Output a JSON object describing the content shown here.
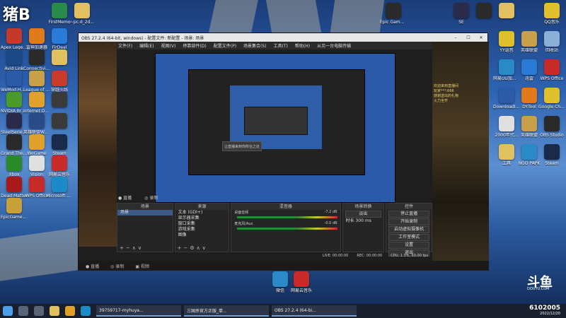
{
  "stream_label": "猪B",
  "desktop_left": [
    {
      "name": "Apex Legends",
      "c": "#c43a2a"
    },
    {
      "name": "雷神加速器",
      "c": "#e07a1a"
    },
    {
      "name": "FirDeal",
      "c": "#2a7ad8"
    },
    {
      "name": "Avid Link",
      "c": "#1a4a88"
    },
    {
      "name": "ConnectivityUtil",
      "c": "#2a2a2a"
    },
    {
      "name": "",
      "c": "#e0c060"
    },
    {
      "name": "WeMod Helper",
      "c": "#2a5aa8"
    },
    {
      "name": "League of Legends",
      "c": "#c8a04a"
    },
    {
      "name": "穿越火线",
      "c": "#c83a2a"
    },
    {
      "name": "NVIDIA Broadcast",
      "c": "#4a9a2a"
    },
    {
      "name": "Internet Download",
      "c": "#e0a02a"
    },
    {
      "name": "",
      "c": "#3a3a3a"
    },
    {
      "name": "SteelSeries GG",
      "c": "#2a2a4a"
    },
    {
      "name": "英雄联盟WeGame",
      "c": "#2a4a88"
    },
    {
      "name": "",
      "c": "#3a3a3a"
    },
    {
      "name": "Grand Theft Auto",
      "c": "#2a2a2a"
    },
    {
      "name": "WeGame",
      "c": "#e0a02a"
    },
    {
      "name": "Steam",
      "c": "#1a2a4a"
    },
    {
      "name": "Xbox",
      "c": "#2a8a2a"
    },
    {
      "name": "Vision",
      "c": "#e0e0e0"
    },
    {
      "name": "网易云音乐",
      "c": "#c82a2a"
    },
    {
      "name": "Dead Matter",
      "c": "#a81a1a"
    },
    {
      "name": "WPS Office",
      "c": "#c82a2a"
    },
    {
      "name": "Microsoft Edge",
      "c": "#1a8ac8"
    },
    {
      "name": "EpicGames Launcher",
      "c": "#c8a03a"
    }
  ],
  "desktop_top": [
    {
      "name": "FirstMemo",
      "c": "#2a8a4a"
    },
    {
      "name": "~pc.d_2d...",
      "c": "#e0c060"
    },
    {
      "name": "Epic Games Launcher",
      "c": "#2a2a2a"
    }
  ],
  "desktop_right": [
    {
      "name": "SE",
      "c": "#2a2a4a"
    },
    {
      "name": "",
      "c": "#2a2a2a"
    },
    {
      "name": "",
      "c": "#e0c060"
    },
    {
      "name": "QQ音乐",
      "c": "#e0c02a"
    },
    {
      "name": "YY语音",
      "c": "#e0c02a"
    },
    {
      "name": "英雄联盟",
      "c": "#c8a04a"
    },
    {
      "name": "回收站",
      "c": "#8ab0d8"
    },
    {
      "name": "网易UU加速器",
      "c": "#2a8ac8"
    },
    {
      "name": "迅雷",
      "c": "#2a7ad8"
    },
    {
      "name": "WPS Office",
      "c": "#c82a2a"
    },
    {
      "name": "DownloadInstaller",
      "c": "#2a5aa8"
    },
    {
      "name": "DYTool",
      "c": "#e07a1a"
    },
    {
      "name": "Google Chrome",
      "c": "#e0c02a"
    },
    {
      "name": "2000年代...",
      "c": "#e0e0e0"
    },
    {
      "name": "英雄联盟",
      "c": "#c8a04a"
    },
    {
      "name": "OBS Studio",
      "c": "#2a2a2a"
    },
    {
      "name": "工具",
      "c": "#e0c060"
    },
    {
      "name": "NGO PAPK",
      "c": "#2a8ac8"
    },
    {
      "name": "Steam",
      "c": "#1a2a4a"
    }
  ],
  "desktop_mid": [
    {
      "name": "微信",
      "c": "#2a8ac8"
    },
    {
      "name": "网易云音乐",
      "c": "#c82a2a"
    }
  ],
  "obs": {
    "title": "OBS 27.2.4 (64-bit, windows) - 配置文件: 新配置 - 场景: 场景",
    "menu": [
      "文件(F)",
      "编辑(E)",
      "视图(V)",
      "停靠部件(D)",
      "配置文件(P)",
      "场景集合(S)",
      "工具(T)",
      "帮助(H)",
      "从另一台电脑传输"
    ],
    "preview_banner": "让直播来到你所在之处",
    "sub_tabs": [
      "● 直播",
      "◎ 录制"
    ],
    "dock_scenes": "场景",
    "dock_sources": "来源",
    "dock_mixer": "混音器",
    "dock_transitions": "场景转换",
    "dock_controls": "控件",
    "scene_items": [
      "场景"
    ],
    "sources": [
      "文本 (GDI+)",
      "显示器采集",
      "窗口采集",
      "游戏采集",
      "图像"
    ],
    "mixer": [
      {
        "label": "桌面音频",
        "db": "-7.2 dB"
      },
      {
        "label": "麦克风/Aux",
        "db": "-0.0 dB"
      }
    ],
    "transition": "淡出",
    "duration_label": "时长",
    "duration": "300 ms",
    "controls": [
      "停止直播",
      "开始录制",
      "启动虚拟摄像机",
      "工作室模式",
      "设置",
      "退出"
    ],
    "status": [
      "LIVE: 00:00:00",
      "REC: 00:00:00",
      "CPU: 1.3%, 60.00 fps"
    ],
    "bottom": [
      "● 直播",
      "◎ 录制",
      "▣ 视频"
    ]
  },
  "chat_lines": [
    "欢迎来到直播间",
    "玩家***:666",
    "感谢送出的礼物",
    "火力全开"
  ],
  "taskbar": {
    "apps": [
      "39759717-myhuya...",
      "三国杀官方正版_单...",
      "OBS 27.2.4 (64-bi..."
    ]
  },
  "watermark": "DOUYU.COM",
  "room_id": "6102005",
  "date": "2022/12/20"
}
